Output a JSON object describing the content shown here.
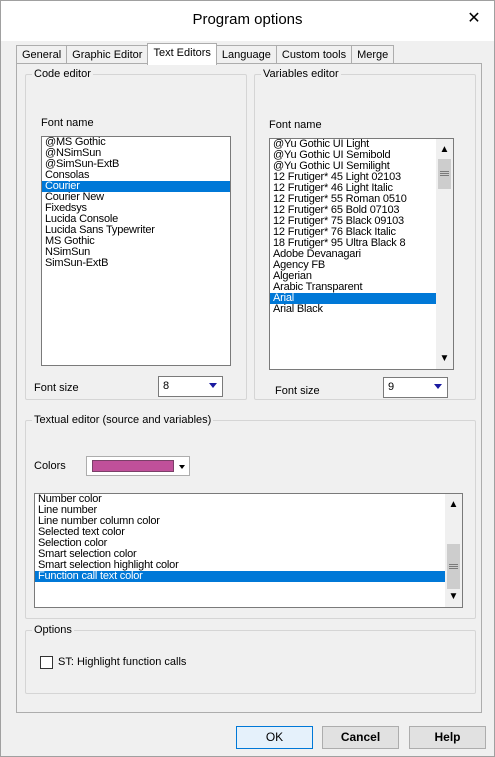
{
  "window": {
    "title": "Program options"
  },
  "icons": {
    "close": "close-icon",
    "up": "scroll-up-arrow-icon",
    "down": "scroll-down-arrow-icon",
    "dropdown": "dropdown-arrow-icon"
  },
  "tabs": [
    {
      "label": "General",
      "active": false
    },
    {
      "label": "Graphic Editor",
      "active": false
    },
    {
      "label": "Text Editors",
      "active": true
    },
    {
      "label": "Language",
      "active": false
    },
    {
      "label": "Custom tools",
      "active": false
    },
    {
      "label": "Merge",
      "active": false
    }
  ],
  "code_editor": {
    "legend": "Code editor",
    "font_name_label": "Font name",
    "fonts": [
      "@MS Gothic",
      "@NSimSun",
      "@SimSun-ExtB",
      "Consolas",
      "Courier",
      "Courier New",
      "Fixedsys",
      "Lucida Console",
      "Lucida Sans Typewriter",
      "MS Gothic",
      "NSimSun",
      "SimSun-ExtB"
    ],
    "selected_font": "Courier",
    "font_size_label": "Font size",
    "font_size": "8"
  },
  "variables_editor": {
    "legend": "Variables editor",
    "font_name_label": "Font name",
    "fonts": [
      "@Yu Gothic UI Light",
      "@Yu Gothic UI Semibold",
      "@Yu Gothic UI Semilight",
      "12 Frutiger* 45 Light  02103",
      "12 Frutiger* 46 Light Italic",
      "12 Frutiger* 55 Roman  0510",
      "12 Frutiger* 65 Bold  07103",
      "12 Frutiger* 75 Black  09103",
      "12 Frutiger* 76 Black Italic",
      "18 Frutiger* 95 Ultra Black  8",
      "Adobe Devanagari",
      "Agency FB",
      "Algerian",
      "Arabic Transparent",
      "Arial",
      "Arial Black"
    ],
    "selected_font": "Arial",
    "font_size_label": "Font size",
    "font_size": "9"
  },
  "textual_editor": {
    "legend": "Textual editor (source and variables)",
    "colors_label": "Colors",
    "current_color": "#c0509a",
    "items": [
      "Number color",
      "Line number",
      "Line number column color",
      "Selected text color",
      "Selection color",
      "Smart selection color",
      "Smart selection highlight color",
      "Function call text color"
    ],
    "selected_item": "Function call text color"
  },
  "options": {
    "legend": "Options",
    "highlight_label": "ST: Highlight function calls",
    "highlight_checked": false
  },
  "buttons": {
    "ok": "OK",
    "cancel": "Cancel",
    "help": "Help"
  },
  "colors": {
    "selection": "#0078d7",
    "window_bg": "#f0f0f0"
  }
}
